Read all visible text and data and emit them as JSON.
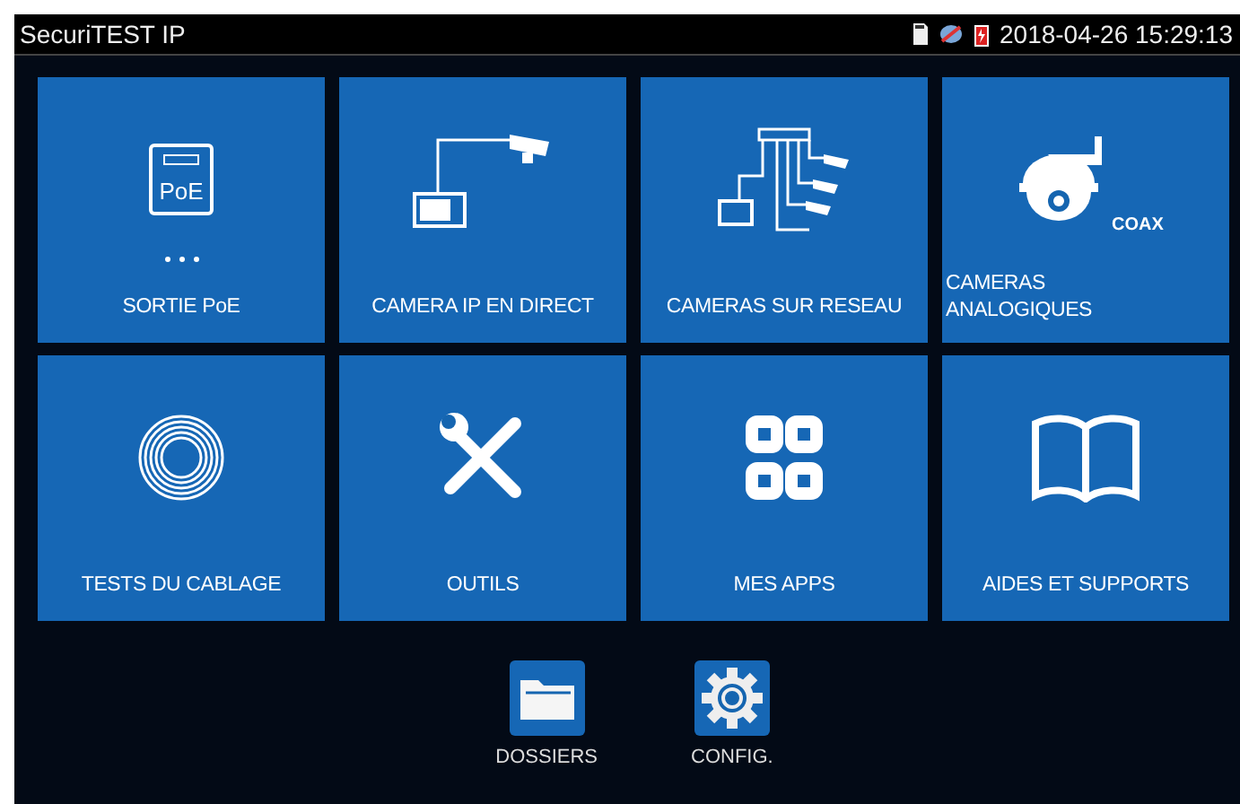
{
  "status_bar": {
    "title": "SecuriTEST IP",
    "datetime": "2018-04-26 15:29:13"
  },
  "tiles": [
    {
      "kind": "poe",
      "label": "SORTIE PoE",
      "icon_text": "PoE"
    },
    {
      "kind": "camera-ip",
      "label": "CAMERA IP EN DIRECT"
    },
    {
      "kind": "network",
      "label": "CAMERAS SUR RESEAU"
    },
    {
      "kind": "dome",
      "label": "CAMERAS ANALOGIQUES",
      "icon_text": "COAX"
    },
    {
      "kind": "cable",
      "label": "TESTS DU CABLAGE"
    },
    {
      "kind": "tools",
      "label": "OUTILS"
    },
    {
      "kind": "apps",
      "label": "MES APPS"
    },
    {
      "kind": "book",
      "label": "AIDES ET SUPPORTS"
    }
  ],
  "dock": [
    {
      "kind": "folder",
      "label": "DOSSIERS"
    },
    {
      "kind": "gear",
      "label": "CONFIG."
    }
  ]
}
